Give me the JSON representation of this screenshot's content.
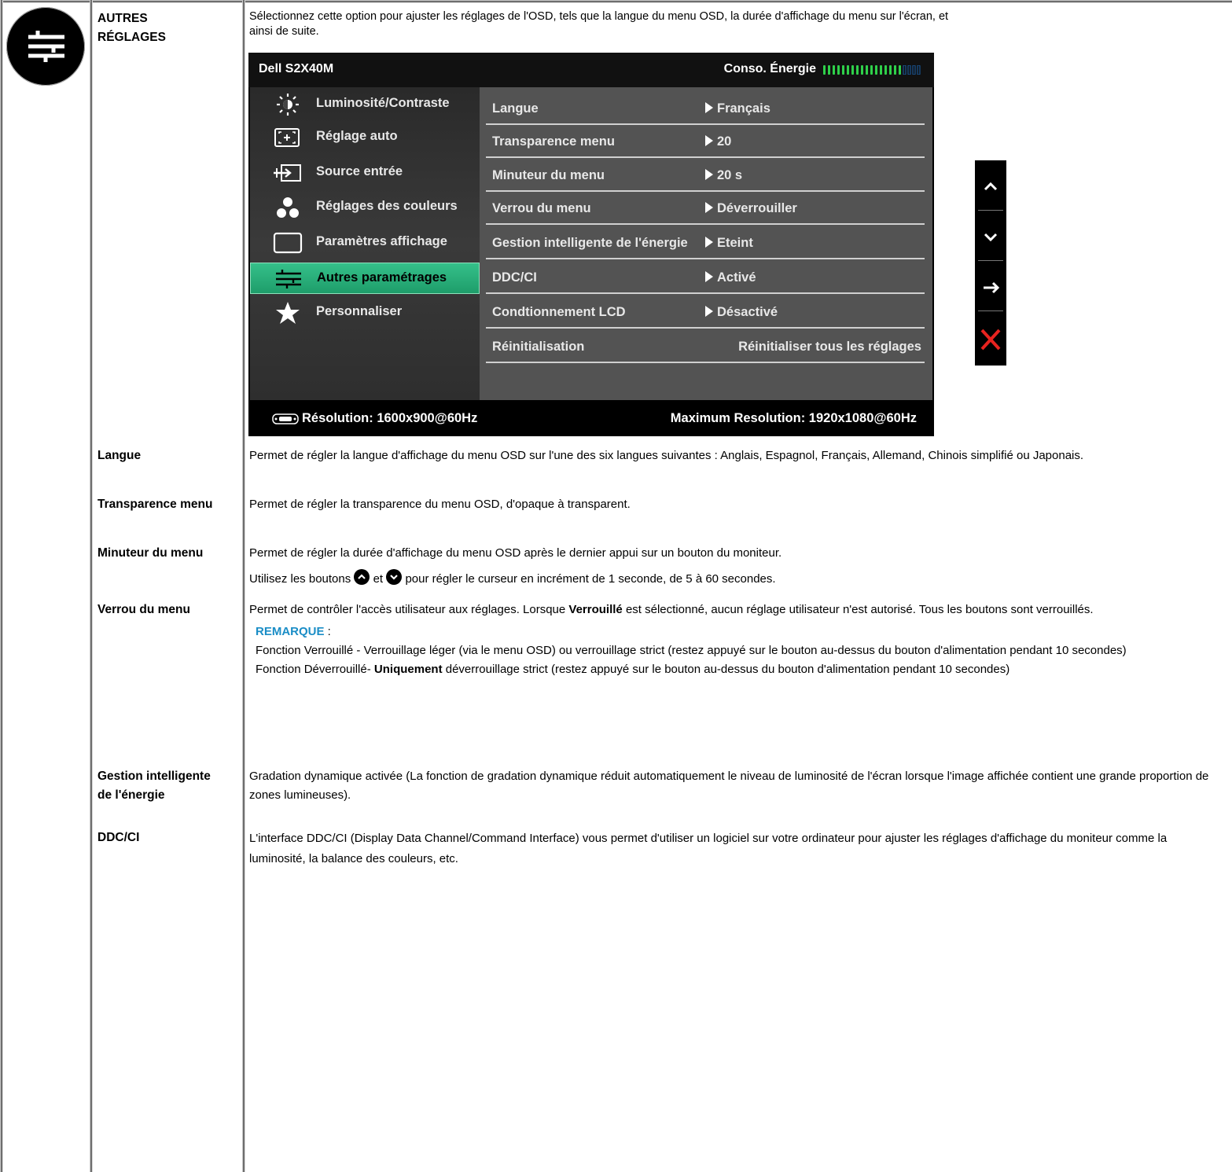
{
  "section": {
    "title": "AUTRES RÉGLAGES",
    "intro": "Sélectionnez cette option pour ajuster les réglages de l'OSD, tels que la langue du menu OSD, la durée d'affichage du menu sur l'écran, et",
    "intro_cont": "ainsi de suite."
  },
  "osd": {
    "model": "Dell S2X40M",
    "energy_label": "Conso. Énergie",
    "energy_level": 0.8,
    "menu": [
      {
        "label": "Luminosité/Contraste",
        "icon": "brightness-icon",
        "selected": false
      },
      {
        "label": "Réglage auto",
        "icon": "auto-adjust-icon",
        "selected": false
      },
      {
        "label": "Source entrée",
        "icon": "input-source-icon",
        "selected": false
      },
      {
        "label": "Réglages des couleurs",
        "icon": "color-settings-icon",
        "selected": false
      },
      {
        "label": "Paramètres affichage",
        "icon": "display-settings-icon",
        "selected": false
      },
      {
        "label": "Autres paramétrages",
        "icon": "other-settings-icon",
        "selected": true
      },
      {
        "label": "Personnaliser",
        "icon": "star-icon",
        "selected": false
      }
    ],
    "settings": [
      {
        "label": "Langue",
        "value": "Français"
      },
      {
        "label": "Transparence menu",
        "value": "20"
      },
      {
        "label": "Minuteur du menu",
        "value": "20 s"
      },
      {
        "label": "Verrou du menu",
        "value": "Déverrouiller"
      },
      {
        "label": "Gestion intelligente de l'énergie",
        "value": "Eteint"
      },
      {
        "label": "DDC/CI",
        "value": "Activé"
      },
      {
        "label": "Condtionnement LCD",
        "value": "Désactivé"
      },
      {
        "label": "Réinitialisation",
        "value": "Réinitialiser tous les réglages"
      }
    ],
    "resolution": "Résolution: 1600x900@60Hz",
    "max_resolution": "Maximum Resolution: 1920x1080@60Hz",
    "colors": {
      "selected": "#2bb07a",
      "energy_on": "#2fd04a",
      "energy_off": "#1a5fa8",
      "close": "#e8231f"
    }
  },
  "keypad": [
    "up-arrow-icon",
    "down-arrow-icon",
    "right-arrow-icon",
    "close-icon"
  ],
  "items": {
    "langue": {
      "term": "Langue",
      "desc": "Permet de régler la langue d'affichage du menu OSD sur l'une des six langues suivantes : Anglais, Espagnol, Français, Allemand, Chinois simplifié ou Japonais."
    },
    "transparence": {
      "term": "Transparence menu",
      "desc": "Permet de régler la transparence du menu OSD, d'opaque à transparent."
    },
    "minuteur": {
      "term": "Minuteur du menu",
      "desc1": "Permet de régler la durée d'affichage du menu OSD après le dernier appui sur un bouton du moniteur.",
      "desc2_a": "Utilisez les boutons ",
      "desc2_b": "et ",
      "desc2_c": "pour régler le curseur en incrément de 1 seconde, de 5 à 60 secondes."
    },
    "verrou": {
      "term": "Verrou du menu",
      "desc_a": "Permet de contrôler l'accès utilisateur aux réglages. Lorsque ",
      "desc_bold": "Verrouillé",
      "desc_b": " est sélectionné, aucun réglage utilisateur n'est autorisé. Tous les boutons sont verrouillés.",
      "note_label": "REMARQUE",
      "note_colon": " :",
      "note1": "Fonction Verrouillé - Verrouillage léger (via le menu OSD) ou verrouillage strict (restez appuyé sur le bouton au-dessus du bouton d'alimentation pendant 10 secondes)",
      "note2_a": "Fonction Déverrouillé- ",
      "note2_bold": "Uniquement",
      "note2_b": " déverrouillage strict (restez appuyé sur le bouton au-dessus du bouton d'alimentation pendant 10 secondes)"
    },
    "gestion": {
      "term": "Gestion intelligente de l'énergie",
      "desc": "Gradation dynamique activée (La fonction de gradation dynamique réduit automatiquement le niveau de luminosité de l'écran lorsque l'image affichée contient une grande proportion de zones lumineuses)."
    },
    "ddc": {
      "term": "DDC/CI",
      "desc": "L'interface DDC/CI (Display Data Channel/Command Interface) vous permet d'utiliser un logiciel sur votre ordinateur pour ajuster les réglages d'affichage du moniteur comme la luminosité, la balance des couleurs, etc."
    }
  }
}
